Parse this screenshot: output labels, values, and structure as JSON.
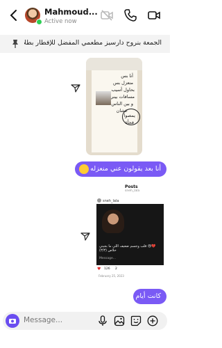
{
  "header": {
    "name": "Mahmoud...",
    "chevron": "›",
    "status": "Active now",
    "icons": [
      "back-arrow-icon",
      "video-off-icon",
      "phone-icon",
      "video-icon"
    ]
  },
  "pinned": {
    "text": "الجمعة بنروح دارسيز مطعمي المفضل للإفطار بطلا..."
  },
  "shared_media_1": {
    "lines": [
      "أنا بس",
      "متعزل بس",
      "بحاول أسيب",
      "مسافات بيني",
      "و بين الناس",
      "عشان",
      "يمصوا",
      "فجأة"
    ]
  },
  "messages": [
    {
      "text": "أنا بعد يقولون عني منعزله"
    },
    {
      "text": "كانت أيام"
    }
  ],
  "shared_post": {
    "title": "Posts",
    "subtitle": "sneh_lala",
    "username": "sneh_lala",
    "caption": "💔😢 قلب وجسم ضعيف اللي ما بجيني خلاص (٣/٣)",
    "message_label": "Message...",
    "likes": "126",
    "comments": "2",
    "date": "February 25, 2023"
  },
  "composer": {
    "placeholder": "Message..."
  },
  "colors": {
    "accent": "#7a5af5",
    "online": "#2fce55"
  }
}
